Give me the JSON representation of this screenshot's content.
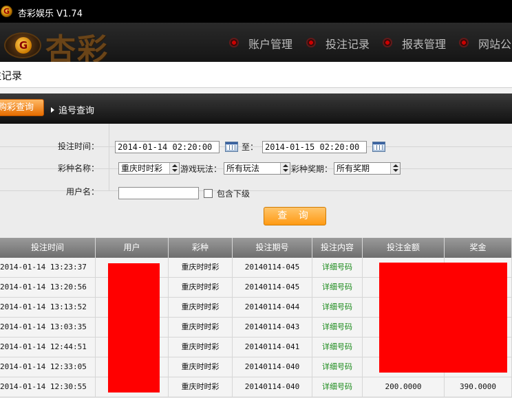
{
  "titlebar": {
    "title": "杏彩娱乐 V1.74",
    "logo_letter": "G"
  },
  "header": {
    "brand": "杏彩",
    "brand_letter": "G",
    "nav": [
      {
        "label": "账户管理"
      },
      {
        "label": "投注记录"
      },
      {
        "label": "报表管理"
      },
      {
        "label": "网站公"
      }
    ]
  },
  "page": {
    "title": "注记录"
  },
  "tabs": {
    "active": "购彩查询",
    "second": "追号查询"
  },
  "form": {
    "time_label": "投注时间：",
    "time_from": "2014-01-14 02:20:00",
    "to_label": "至：",
    "time_to": "2014-01-15 02:20:00",
    "lottery_label": "彩种名称：",
    "lottery_value": "重庆时时彩",
    "play_label": "游戏玩法：",
    "play_value": "所有玩法",
    "period_label": "彩种奖期：",
    "period_value": "所有奖期",
    "user_label": "用户名：",
    "user_value": "",
    "include_sub_label": "包含下级",
    "include_sub_checked": false,
    "query_button": "查 询"
  },
  "table": {
    "headers": [
      "投注时间",
      "用户",
      "彩种",
      "投注期号",
      "投注内容",
      "投注金额",
      "奖金"
    ],
    "rows": [
      {
        "time": "2014-01-14 13:23:37",
        "user": "",
        "lottery": "重庆时时彩",
        "issue": "20140114-045",
        "content": "详细号码",
        "amount": "",
        "prize": ""
      },
      {
        "time": "2014-01-14 13:20:56",
        "user": "",
        "lottery": "重庆时时彩",
        "issue": "20140114-045",
        "content": "详细号码",
        "amount": "",
        "prize": ""
      },
      {
        "time": "2014-01-14 13:13:52",
        "user": "",
        "lottery": "重庆时时彩",
        "issue": "20140114-044",
        "content": "详细号码",
        "amount": "",
        "prize": ""
      },
      {
        "time": "2014-01-14 13:03:35",
        "user": "",
        "lottery": "重庆时时彩",
        "issue": "20140114-043",
        "content": "详细号码",
        "amount": "",
        "prize": ""
      },
      {
        "time": "2014-01-14 12:44:51",
        "user": "",
        "lottery": "重庆时时彩",
        "issue": "20140114-041",
        "content": "详细号码",
        "amount": "",
        "prize": ""
      },
      {
        "time": "2014-01-14 12:33:05",
        "user": "",
        "lottery": "重庆时时彩",
        "issue": "20140114-040",
        "content": "详细号码",
        "amount": "",
        "prize": ""
      },
      {
        "time": "2014-01-14 12:30:55",
        "user": "",
        "lottery": "重庆时时彩",
        "issue": "20140114-040",
        "content": "详细号码",
        "amount": "200.0000",
        "prize": "390.0000"
      }
    ]
  },
  "colors": {
    "accent": "#ff9a13",
    "redaction": "#ff0000",
    "link": "#1a8a1a"
  }
}
